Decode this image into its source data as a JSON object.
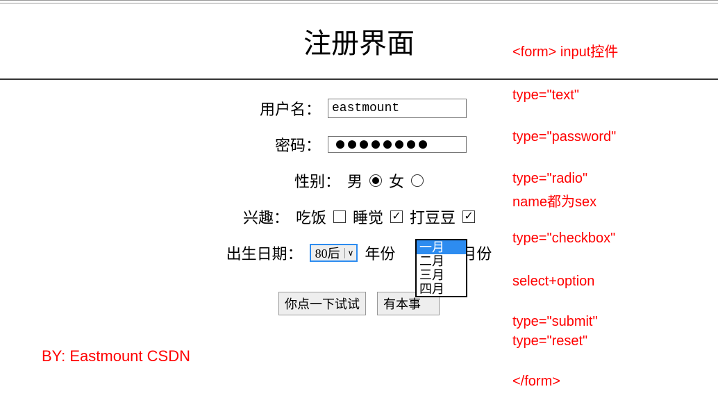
{
  "title": "注册界面",
  "form": {
    "username": {
      "label": "用户名：",
      "value": "eastmount"
    },
    "password": {
      "label": "密码：",
      "dotCount": 8
    },
    "gender": {
      "label": "性别：",
      "male": "男",
      "female": "女",
      "selected": "male"
    },
    "hobby": {
      "label": "兴趣：",
      "eat": {
        "label": "吃饭",
        "checked": false
      },
      "sleep": {
        "label": "睡觉",
        "checked": true
      },
      "beat": {
        "label": "打豆豆",
        "checked": true
      }
    },
    "birth": {
      "label": "出生日期：",
      "yearSelect": {
        "value": "80后"
      },
      "yearSuffix": "年份",
      "monthSuffix": "月份",
      "monthOptions": [
        "一月",
        "二月",
        "三月",
        "四月"
      ],
      "monthSelectedIndex": 0
    },
    "buttons": {
      "submit": "你点一下试试",
      "reset": "有本事"
    }
  },
  "annotations": {
    "a0": "<form> input控件",
    "a1": "type=\"text\"",
    "a2": "type=\"password\"",
    "a3": "type=\"radio\"",
    "a4": "name都为sex",
    "a5": "type=\"checkbox\"",
    "a6": "select+option",
    "a7": "type=\"submit\"",
    "a8": "type=\"reset\"",
    "a9": "</form>"
  },
  "byline": "BY: Eastmount CSDN"
}
